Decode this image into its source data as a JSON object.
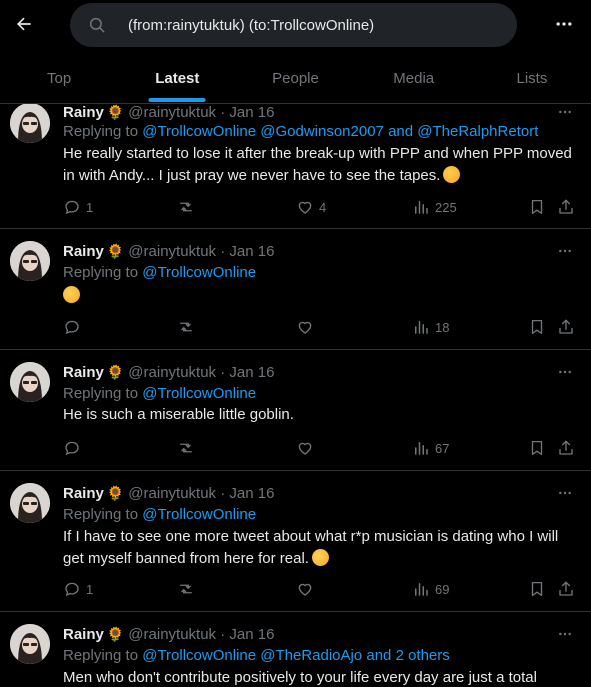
{
  "search": {
    "query": "(from:rainytuktuk) (to:TrollcowOnline)"
  },
  "tabs": [
    {
      "label": "Top"
    },
    {
      "label": "Latest"
    },
    {
      "label": "People"
    },
    {
      "label": "Media"
    },
    {
      "label": "Lists"
    }
  ],
  "active_tab": "Latest",
  "colors": {
    "accent": "#1d9bf0",
    "background": "#000000",
    "muted": "#71767b",
    "text": "#e7e9ea",
    "divider": "#2f3336"
  },
  "tweets": [
    {
      "name": "Rainy",
      "badge": "🌻",
      "handle": "@rainytuktuk",
      "dot": "·",
      "date": "Jan 16",
      "reply_prefix": "Replying to",
      "reply_to": "@TrollcowOnline @Godwinson2007 and @TheRalphRetort",
      "text": "He really started to lose it after the break-up with PPP and when PPP moved in with Andy... I just pray we never have to see the tapes.",
      "text_emoji": "face-with-hand-over-mouth",
      "replies": "1",
      "retweets": "",
      "likes": "4",
      "views": "225"
    },
    {
      "name": "Rainy",
      "badge": "🌻",
      "handle": "@rainytuktuk",
      "dot": "·",
      "date": "Jan 16",
      "reply_prefix": "Replying to",
      "reply_to": "@TrollcowOnline",
      "text": "",
      "text_emoji": "thinking-face",
      "replies": "",
      "retweets": "",
      "likes": "",
      "views": "18"
    },
    {
      "name": "Rainy",
      "badge": "🌻",
      "handle": "@rainytuktuk",
      "dot": "·",
      "date": "Jan 16",
      "reply_prefix": "Replying to",
      "reply_to": "@TrollcowOnline",
      "text": "He is such a miserable little goblin.",
      "text_emoji": "",
      "replies": "",
      "retweets": "",
      "likes": "",
      "views": "67"
    },
    {
      "name": "Rainy",
      "badge": "🌻",
      "handle": "@rainytuktuk",
      "dot": "·",
      "date": "Jan 16",
      "reply_prefix": "Replying to",
      "reply_to": "@TrollcowOnline",
      "text": "If I have to see one more tweet about what r*p musician is dating who I will get myself banned from here for real.",
      "text_emoji": "face-with-steam-from-nose",
      "replies": "1",
      "retweets": "",
      "likes": "",
      "views": "69"
    },
    {
      "name": "Rainy",
      "badge": "🌻",
      "handle": "@rainytuktuk",
      "dot": "·",
      "date": "Jan 16",
      "reply_prefix": "Replying to",
      "reply_to": "@TrollcowOnline @TheRadioAjo and 2 others",
      "text": "Men who don't contribute positively to your life every day are just a total",
      "text_emoji": "",
      "replies": "",
      "retweets": "",
      "likes": "",
      "views": ""
    }
  ]
}
